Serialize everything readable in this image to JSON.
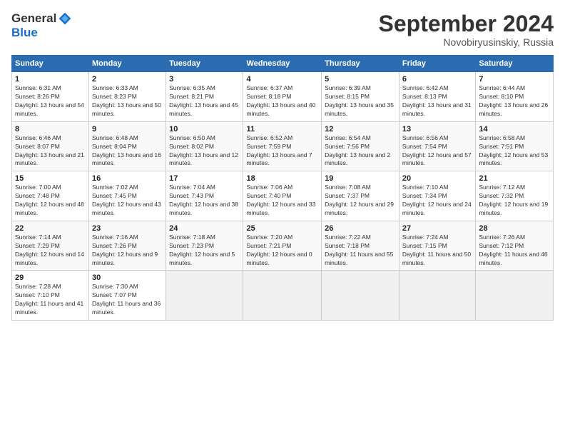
{
  "header": {
    "logo_general": "General",
    "logo_blue": "Blue",
    "month_title": "September 2024",
    "subtitle": "Novobiryusinskiy, Russia"
  },
  "days_of_week": [
    "Sunday",
    "Monday",
    "Tuesday",
    "Wednesday",
    "Thursday",
    "Friday",
    "Saturday"
  ],
  "weeks": [
    [
      {
        "day": "1",
        "sunrise": "6:31 AM",
        "sunset": "8:26 PM",
        "daylight": "13 hours and 54 minutes."
      },
      {
        "day": "2",
        "sunrise": "6:33 AM",
        "sunset": "8:23 PM",
        "daylight": "13 hours and 50 minutes."
      },
      {
        "day": "3",
        "sunrise": "6:35 AM",
        "sunset": "8:21 PM",
        "daylight": "13 hours and 45 minutes."
      },
      {
        "day": "4",
        "sunrise": "6:37 AM",
        "sunset": "8:18 PM",
        "daylight": "13 hours and 40 minutes."
      },
      {
        "day": "5",
        "sunrise": "6:39 AM",
        "sunset": "8:15 PM",
        "daylight": "13 hours and 35 minutes."
      },
      {
        "day": "6",
        "sunrise": "6:42 AM",
        "sunset": "8:13 PM",
        "daylight": "13 hours and 31 minutes."
      },
      {
        "day": "7",
        "sunrise": "6:44 AM",
        "sunset": "8:10 PM",
        "daylight": "13 hours and 26 minutes."
      }
    ],
    [
      {
        "day": "8",
        "sunrise": "6:46 AM",
        "sunset": "8:07 PM",
        "daylight": "13 hours and 21 minutes."
      },
      {
        "day": "9",
        "sunrise": "6:48 AM",
        "sunset": "8:04 PM",
        "daylight": "13 hours and 16 minutes."
      },
      {
        "day": "10",
        "sunrise": "6:50 AM",
        "sunset": "8:02 PM",
        "daylight": "13 hours and 12 minutes."
      },
      {
        "day": "11",
        "sunrise": "6:52 AM",
        "sunset": "7:59 PM",
        "daylight": "13 hours and 7 minutes."
      },
      {
        "day": "12",
        "sunrise": "6:54 AM",
        "sunset": "7:56 PM",
        "daylight": "13 hours and 2 minutes."
      },
      {
        "day": "13",
        "sunrise": "6:56 AM",
        "sunset": "7:54 PM",
        "daylight": "12 hours and 57 minutes."
      },
      {
        "day": "14",
        "sunrise": "6:58 AM",
        "sunset": "7:51 PM",
        "daylight": "12 hours and 53 minutes."
      }
    ],
    [
      {
        "day": "15",
        "sunrise": "7:00 AM",
        "sunset": "7:48 PM",
        "daylight": "12 hours and 48 minutes."
      },
      {
        "day": "16",
        "sunrise": "7:02 AM",
        "sunset": "7:45 PM",
        "daylight": "12 hours and 43 minutes."
      },
      {
        "day": "17",
        "sunrise": "7:04 AM",
        "sunset": "7:43 PM",
        "daylight": "12 hours and 38 minutes."
      },
      {
        "day": "18",
        "sunrise": "7:06 AM",
        "sunset": "7:40 PM",
        "daylight": "12 hours and 33 minutes."
      },
      {
        "day": "19",
        "sunrise": "7:08 AM",
        "sunset": "7:37 PM",
        "daylight": "12 hours and 29 minutes."
      },
      {
        "day": "20",
        "sunrise": "7:10 AM",
        "sunset": "7:34 PM",
        "daylight": "12 hours and 24 minutes."
      },
      {
        "day": "21",
        "sunrise": "7:12 AM",
        "sunset": "7:32 PM",
        "daylight": "12 hours and 19 minutes."
      }
    ],
    [
      {
        "day": "22",
        "sunrise": "7:14 AM",
        "sunset": "7:29 PM",
        "daylight": "12 hours and 14 minutes."
      },
      {
        "day": "23",
        "sunrise": "7:16 AM",
        "sunset": "7:26 PM",
        "daylight": "12 hours and 9 minutes."
      },
      {
        "day": "24",
        "sunrise": "7:18 AM",
        "sunset": "7:23 PM",
        "daylight": "12 hours and 5 minutes."
      },
      {
        "day": "25",
        "sunrise": "7:20 AM",
        "sunset": "7:21 PM",
        "daylight": "12 hours and 0 minutes."
      },
      {
        "day": "26",
        "sunrise": "7:22 AM",
        "sunset": "7:18 PM",
        "daylight": "11 hours and 55 minutes."
      },
      {
        "day": "27",
        "sunrise": "7:24 AM",
        "sunset": "7:15 PM",
        "daylight": "11 hours and 50 minutes."
      },
      {
        "day": "28",
        "sunrise": "7:26 AM",
        "sunset": "7:12 PM",
        "daylight": "11 hours and 46 minutes."
      }
    ],
    [
      {
        "day": "29",
        "sunrise": "7:28 AM",
        "sunset": "7:10 PM",
        "daylight": "11 hours and 41 minutes."
      },
      {
        "day": "30",
        "sunrise": "7:30 AM",
        "sunset": "7:07 PM",
        "daylight": "11 hours and 36 minutes."
      },
      null,
      null,
      null,
      null,
      null
    ]
  ]
}
